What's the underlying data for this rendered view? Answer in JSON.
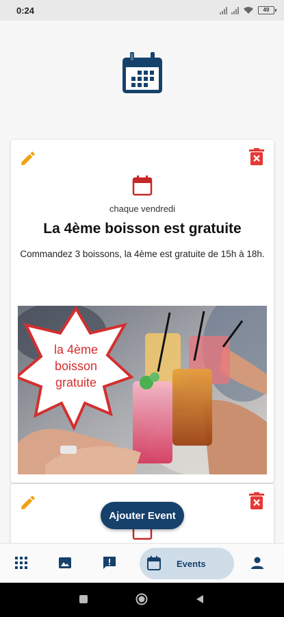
{
  "status_bar": {
    "time": "0:24",
    "battery": "49"
  },
  "events": [
    {
      "recurrence": "chaque vendredi",
      "title": "La 4ème boisson est gratuite",
      "description": "Commandez 3 boissons, la 4ème est gratuite de 15h à 18h.",
      "image_caption_lines": [
        "la 4ème",
        "boisson",
        "gratuite"
      ]
    }
  ],
  "fab": {
    "label": "Ajouter Event"
  },
  "bottom_nav": {
    "items": [
      {
        "icon": "grid-icon"
      },
      {
        "icon": "image-icon"
      },
      {
        "icon": "feedback-icon"
      },
      {
        "icon": "calendar-icon",
        "label": "Events",
        "active": true
      },
      {
        "icon": "person-icon"
      }
    ]
  },
  "colors": {
    "primary": "#16416b",
    "active_pill": "#cfdde9",
    "edit": "#f2a20f",
    "delete": "#e53935",
    "accent_red": "#d32f2f"
  }
}
